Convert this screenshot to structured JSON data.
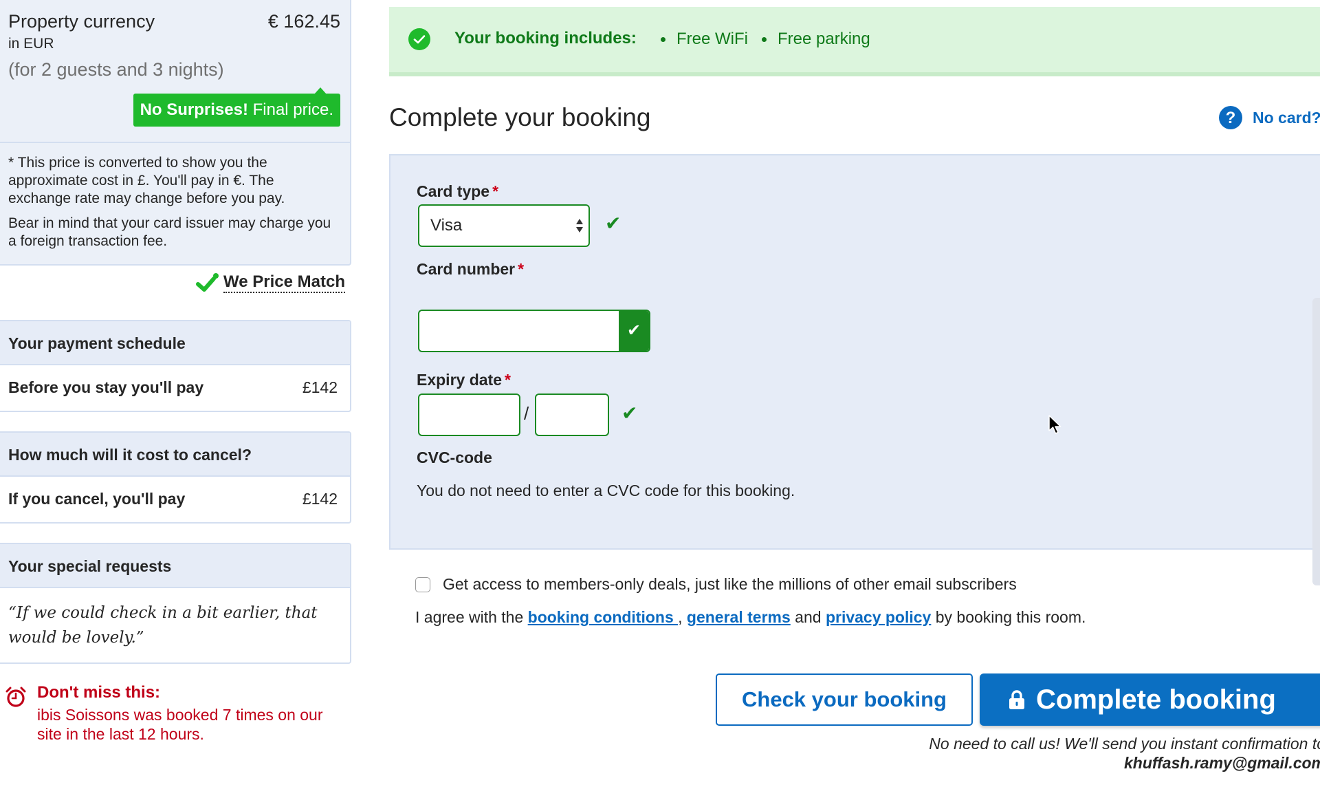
{
  "price_panel": {
    "label": "Property currency",
    "sublabel": "in EUR",
    "value": "€ 162.45",
    "guests": "(for 2 guests and 3 nights)",
    "badge_bold": "No Surprises!",
    "badge_text": " Final price.",
    "note_1": "* This price is converted to show you the approximate cost in £. You'll pay in €. The exchange rate may change before you pay.",
    "note_2": "Bear in mind that your card issuer may charge you a foreign transaction fee."
  },
  "price_match": {
    "label": "We Price Match",
    "icon": "check-icon"
  },
  "payment_schedule": {
    "title": "Your payment schedule",
    "row_label": "Before you stay you'll pay",
    "row_value": "£142"
  },
  "cancellation": {
    "title": "How much will it cost to cancel?",
    "row_label": "If you cancel, you'll pay",
    "row_value": "£142"
  },
  "special_requests": {
    "title": "Your special requests",
    "quote": "“If we could check in a bit earlier, that would be lovely.”"
  },
  "dont_miss": {
    "icon": "alarm-clock-icon",
    "title": "Don't miss this:",
    "text": "ibis Soissons was booked 7 times on our site in the last 12 hours."
  },
  "includes": {
    "icon": "check-circle-icon",
    "title": "Your booking includes:",
    "items": [
      "Free WiFi",
      "Free parking"
    ]
  },
  "main": {
    "title": "Complete your booking",
    "no_card_label": "No card?",
    "no_card_icon": "help-icon"
  },
  "form": {
    "required_mark": "*",
    "card_type_label": "Card type",
    "card_type_value": "Visa",
    "card_number_label": "Card number",
    "card_number_value": "",
    "expiry_label": "Expiry date",
    "expiry_separator": "/",
    "expiry_month_value": "",
    "expiry_year_value": "",
    "cvc_label": "CVC-code",
    "cvc_text": "You do not need to enter a CVC code for this booking.",
    "valid_mark": "✔"
  },
  "consent": {
    "newsletter_label": "Get access to members-only deals, just like the millions of other email subscribers",
    "newsletter_checked": false,
    "agree_prefix": "I agree with the ",
    "link_booking_conditions": "booking conditions ",
    "sep_comma": ", ",
    "link_general_terms": "general terms",
    "sep_and": " and ",
    "link_privacy_policy": "privacy policy",
    "agree_suffix": " by booking this room."
  },
  "actions": {
    "check_label": "Check your booking",
    "complete_label": "Complete booking",
    "confirm_text": "No need to call us! We'll send you instant confirmation to",
    "confirm_email": "khuffash.ramy@gmail.com"
  },
  "colors": {
    "brand_blue": "#0b6fc2",
    "success_green": "#1fba2c",
    "valid_green": "#1a8a22",
    "alert_red": "#c00018",
    "panel_bg": "#e6ecf7"
  }
}
